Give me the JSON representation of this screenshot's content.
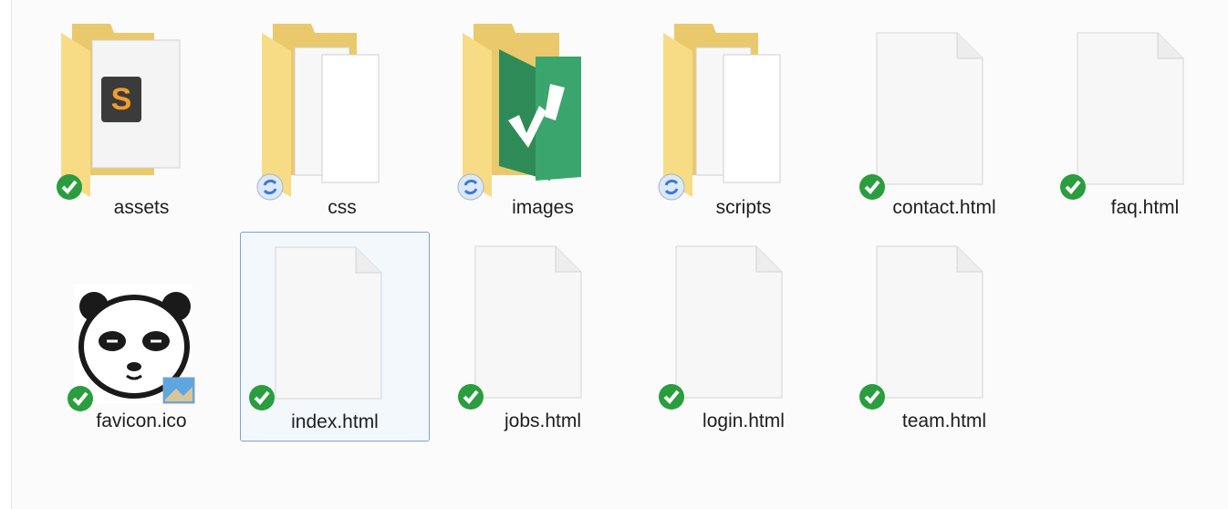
{
  "items": [
    {
      "name": "assets",
      "type": "folder",
      "icon": "sublime-folder-icon",
      "status": "synced"
    },
    {
      "name": "css",
      "type": "folder",
      "icon": "documents-folder-icon",
      "status": "syncing"
    },
    {
      "name": "images",
      "type": "folder",
      "icon": "vim-folder-icon",
      "status": "syncing"
    },
    {
      "name": "scripts",
      "type": "folder",
      "icon": "documents-folder-icon",
      "status": "syncing"
    },
    {
      "name": "contact.html",
      "type": "file",
      "icon": "file-icon",
      "status": "synced"
    },
    {
      "name": "faq.html",
      "type": "file",
      "icon": "file-icon",
      "status": "synced"
    },
    {
      "name": "favicon.ico",
      "type": "image",
      "icon": "panda-favicon-icon",
      "status": "synced"
    },
    {
      "name": "index.html",
      "type": "file",
      "icon": "file-icon",
      "status": "synced",
      "selected": true
    },
    {
      "name": "jobs.html",
      "type": "file",
      "icon": "file-icon",
      "status": "synced"
    },
    {
      "name": "login.html",
      "type": "file",
      "icon": "file-icon",
      "status": "synced"
    },
    {
      "name": "team.html",
      "type": "file",
      "icon": "file-icon",
      "status": "synced"
    }
  ],
  "colors": {
    "synced": "#2a9d3e",
    "syncing": "#3a7bd5",
    "folder": "#f5d97a",
    "selection": "#7da2ce"
  }
}
